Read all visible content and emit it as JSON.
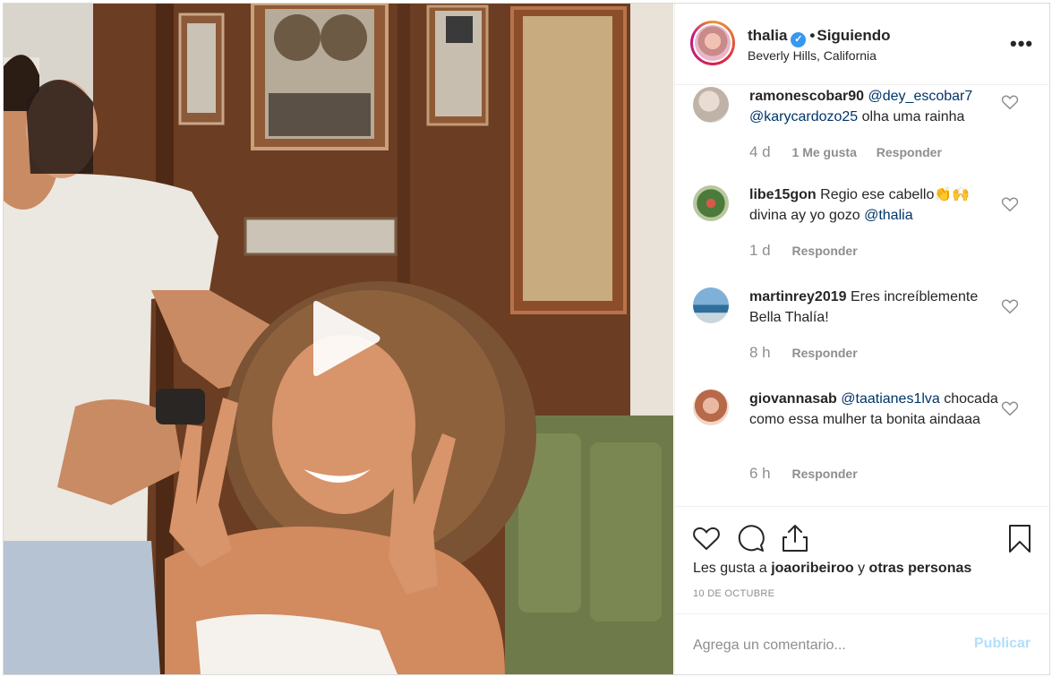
{
  "header": {
    "username": "thalia",
    "separator": "•",
    "follow_status": "Siguiendo",
    "location": "Beverly Hills, California",
    "more_icon": "ellipsis-icon",
    "verified_icon": "verified-badge-icon"
  },
  "media": {
    "type": "video",
    "play_icon": "play-icon"
  },
  "comments": [
    {
      "username": "ramonescobar90",
      "mentions": [
        "@dey_escobar7",
        "@karycardozo25"
      ],
      "text": "olha uma rainha",
      "age": "4 d",
      "likes": "1 Me gusta",
      "reply": "Responder"
    },
    {
      "username": "libe15gon",
      "text": "Regio ese cabello👏🙌 divina ay yo gozo",
      "mention": "@thalia",
      "age": "1 d",
      "reply": "Responder"
    },
    {
      "username": "martinrey2019",
      "text": "Eres increíblemente Bella Thalía!",
      "age": "8 h",
      "reply": "Responder"
    },
    {
      "username": "giovannasab",
      "mention": "@taatianes1lva",
      "text": "chocada como essa mulher ta bonita aindaaa",
      "age": "6 h",
      "reply": "Responder"
    }
  ],
  "actions": {
    "like_icon": "heart-icon",
    "comment_icon": "comment-icon",
    "share_icon": "share-icon",
    "save_icon": "bookmark-icon"
  },
  "likes_line": {
    "prefix": "Les gusta a",
    "user": "joaoribeiroo",
    "conjunction": "y",
    "others": "otras personas"
  },
  "date": "10 DE OCTUBRE",
  "add_comment": {
    "placeholder": "Agrega un comentario...",
    "publish_label": "Publicar"
  },
  "colors": {
    "link": "#003569",
    "verified": "#3897f0",
    "publish_disabled": "#b2dffc",
    "muted": "#8e8e8e"
  }
}
